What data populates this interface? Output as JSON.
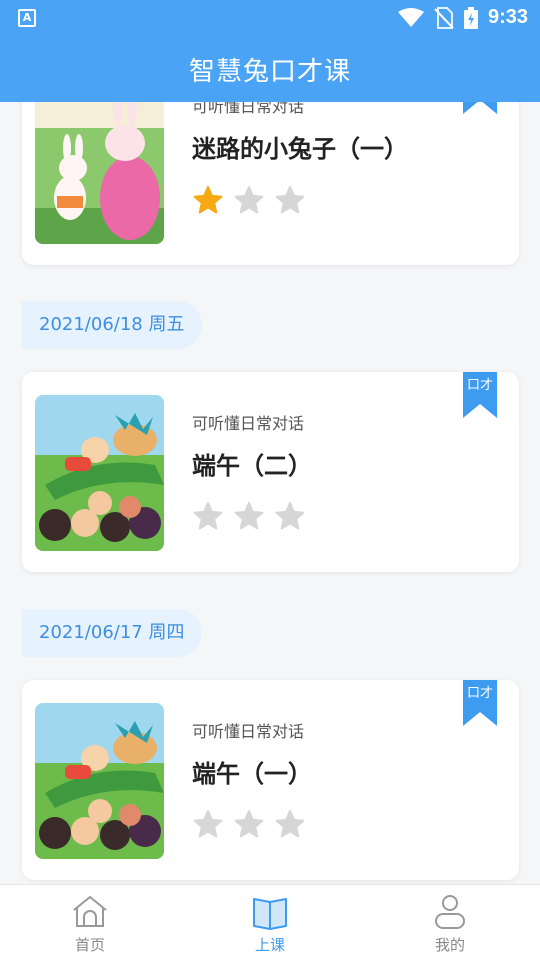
{
  "status_bar": {
    "time": "9:33",
    "app_badge": "A"
  },
  "header": {
    "title": "智慧兔口才课"
  },
  "cards": [
    {
      "subtitle": "可听懂日常对话",
      "title": "迷路的小兔子（一）",
      "rating": 1,
      "max_rating": 3,
      "badge": ""
    },
    {
      "subtitle": "可听懂日常对话",
      "title": "端午（二）",
      "rating": 0,
      "max_rating": 3,
      "badge": "口才"
    },
    {
      "subtitle": "可听懂日常对话",
      "title": "端午（一）",
      "rating": 0,
      "max_rating": 3,
      "badge": "口才"
    }
  ],
  "dates": [
    "2021/06/18 周五",
    "2021/06/17 周四"
  ],
  "tabbar": {
    "items": [
      {
        "label": "首页",
        "icon": "home-icon",
        "active": false
      },
      {
        "label": "上课",
        "icon": "book-icon",
        "active": true
      },
      {
        "label": "我的",
        "icon": "profile-icon",
        "active": false
      }
    ]
  },
  "colors": {
    "primary": "#4aa3f5",
    "accent": "#3d9bf0",
    "star_active": "#f6a911",
    "star_inactive": "#d6d6d6",
    "date_bg": "#e6f2fd"
  }
}
